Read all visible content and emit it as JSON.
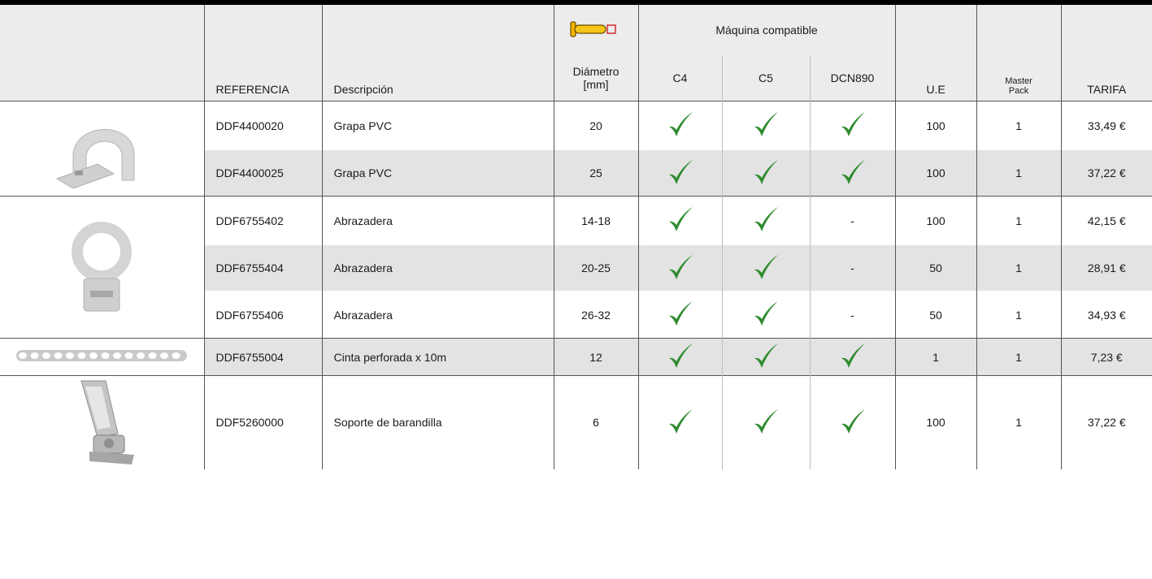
{
  "header": {
    "machine_group": "Máquina compatible",
    "columns": {
      "referencia": "REFERENCIA",
      "descripcion": "Descripción",
      "diametro_line1": "Diámetro",
      "diametro_line2": "[mm]",
      "c4": "C4",
      "c5": "C5",
      "dcn890": "DCN890",
      "ue": "U.E",
      "master_line1": "Master",
      "master_line2": "Pack",
      "tarifa": "TARIFA"
    },
    "diameter_icon": "pin-diameter-icon"
  },
  "icons": {
    "compatible": "check-icon",
    "compatible_color": "#2e8b2e"
  },
  "rows": [
    {
      "ref": "DDF4400020",
      "desc": "Grapa PVC",
      "diam": "20",
      "c4": true,
      "c5": true,
      "dcn890": true,
      "ue": "100",
      "master": "1",
      "tarifa": "33,49 €"
    },
    {
      "ref": "DDF4400025",
      "desc": "Grapa PVC",
      "diam": "25",
      "c4": true,
      "c5": true,
      "dcn890": true,
      "ue": "100",
      "master": "1",
      "tarifa": "37,22 €"
    },
    {
      "ref": "DDF6755402",
      "desc": "Abrazadera",
      "diam": "14-18",
      "c4": true,
      "c5": true,
      "dcn890": "-",
      "ue": "100",
      "master": "1",
      "tarifa": "42,15 €"
    },
    {
      "ref": "DDF6755404",
      "desc": "Abrazadera",
      "diam": "20-25",
      "c4": true,
      "c5": true,
      "dcn890": "-",
      "ue": "50",
      "master": "1",
      "tarifa": "28,91 €"
    },
    {
      "ref": "DDF6755406",
      "desc": "Abrazadera",
      "diam": "26-32",
      "c4": true,
      "c5": true,
      "dcn890": "-",
      "ue": "50",
      "master": "1",
      "tarifa": "34,93 €"
    },
    {
      "ref": "DDF6755004",
      "desc": "Cinta perforada x 10m",
      "diam": "12",
      "c4": true,
      "c5": true,
      "dcn890": true,
      "ue": "1",
      "master": "1",
      "tarifa": "7,23 €"
    },
    {
      "ref": "DDF5260000",
      "desc": "Soporte de barandilla",
      "diam": "6",
      "c4": true,
      "c5": true,
      "dcn890": true,
      "ue": "100",
      "master": "1",
      "tarifa": "37,22 €"
    }
  ],
  "product_images": [
    {
      "name": "pvc-clip-image",
      "rows": 2
    },
    {
      "name": "clamp-image",
      "rows": 3
    },
    {
      "name": "perforated-tape-image",
      "rows": 1
    },
    {
      "name": "railing-bracket-image",
      "rows": 1
    }
  ]
}
